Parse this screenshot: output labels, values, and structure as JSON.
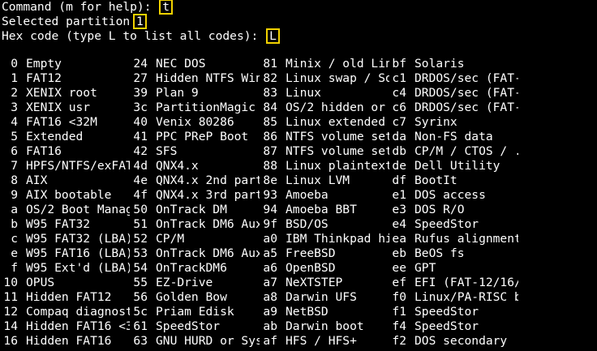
{
  "terminal": {
    "prompts": [
      {
        "text": "Command (m for help): ",
        "input": "t"
      },
      {
        "text": "Selected partition ",
        "input": "1"
      },
      {
        "text": "Hex code (type L to list all codes): ",
        "input": "L"
      }
    ],
    "partition_types": [
      [
        [
          "0",
          "Empty"
        ],
        [
          "24",
          "NEC DOS"
        ],
        [
          "81",
          "Minix / old Lin"
        ],
        [
          "bf",
          "Solaris"
        ]
      ],
      [
        [
          "1",
          "FAT12"
        ],
        [
          "27",
          "Hidden NTFS Win"
        ],
        [
          "82",
          "Linux swap / So"
        ],
        [
          "c1",
          "DRDOS/sec (FAT-"
        ]
      ],
      [
        [
          "2",
          "XENIX root"
        ],
        [
          "39",
          "Plan 9"
        ],
        [
          "83",
          "Linux"
        ],
        [
          "c4",
          "DRDOS/sec (FAT-"
        ]
      ],
      [
        [
          "3",
          "XENIX usr"
        ],
        [
          "3c",
          "PartitionMagic"
        ],
        [
          "84",
          "OS/2 hidden or"
        ],
        [
          "c6",
          "DRDOS/sec (FAT-"
        ]
      ],
      [
        [
          "4",
          "FAT16 <32M"
        ],
        [
          "40",
          "Venix 80286"
        ],
        [
          "85",
          "Linux extended"
        ],
        [
          "c7",
          "Syrinx"
        ]
      ],
      [
        [
          "5",
          "Extended"
        ],
        [
          "41",
          "PPC PReP Boot"
        ],
        [
          "86",
          "NTFS volume set"
        ],
        [
          "da",
          "Non-FS data"
        ]
      ],
      [
        [
          "6",
          "FAT16"
        ],
        [
          "42",
          "SFS"
        ],
        [
          "87",
          "NTFS volume set"
        ],
        [
          "db",
          "CP/M / CTOS / ."
        ]
      ],
      [
        [
          "7",
          "HPFS/NTFS/exFAT"
        ],
        [
          "4d",
          "QNX4.x"
        ],
        [
          "88",
          "Linux plaintext"
        ],
        [
          "de",
          "Dell Utility"
        ]
      ],
      [
        [
          "8",
          "AIX"
        ],
        [
          "4e",
          "QNX4.x 2nd part"
        ],
        [
          "8e",
          "Linux LVM"
        ],
        [
          "df",
          "BootIt"
        ]
      ],
      [
        [
          "9",
          "AIX bootable"
        ],
        [
          "4f",
          "QNX4.x 3rd part"
        ],
        [
          "93",
          "Amoeba"
        ],
        [
          "e1",
          "DOS access"
        ]
      ],
      [
        [
          "a",
          "OS/2 Boot Manag"
        ],
        [
          "50",
          "OnTrack DM"
        ],
        [
          "94",
          "Amoeba BBT"
        ],
        [
          "e3",
          "DOS R/O"
        ]
      ],
      [
        [
          "b",
          "W95 FAT32"
        ],
        [
          "51",
          "OnTrack DM6 Aux"
        ],
        [
          "9f",
          "BSD/OS"
        ],
        [
          "e4",
          "SpeedStor"
        ]
      ],
      [
        [
          "c",
          "W95 FAT32 (LBA)"
        ],
        [
          "52",
          "CP/M"
        ],
        [
          "a0",
          "IBM Thinkpad hi"
        ],
        [
          "ea",
          "Rufus alignment"
        ]
      ],
      [
        [
          "e",
          "W95 FAT16 (LBA)"
        ],
        [
          "53",
          "OnTrack DM6 Aux"
        ],
        [
          "a5",
          "FreeBSD"
        ],
        [
          "eb",
          "BeOS fs"
        ]
      ],
      [
        [
          "f",
          "W95 Ext'd (LBA)"
        ],
        [
          "54",
          "OnTrackDM6"
        ],
        [
          "a6",
          "OpenBSD"
        ],
        [
          "ee",
          "GPT"
        ]
      ],
      [
        [
          "10",
          "OPUS"
        ],
        [
          "55",
          "EZ-Drive"
        ],
        [
          "a7",
          "NeXTSTEP"
        ],
        [
          "ef",
          "EFI (FAT-12/16/"
        ]
      ],
      [
        [
          "11",
          "Hidden FAT12"
        ],
        [
          "56",
          "Golden Bow"
        ],
        [
          "a8",
          "Darwin UFS"
        ],
        [
          "f0",
          "Linux/PA-RISC b"
        ]
      ],
      [
        [
          "12",
          "Compaq diagnost"
        ],
        [
          "5c",
          "Priam Edisk"
        ],
        [
          "a9",
          "NetBSD"
        ],
        [
          "f1",
          "SpeedStor"
        ]
      ],
      [
        [
          "14",
          "Hidden FAT16 <3"
        ],
        [
          "61",
          "SpeedStor"
        ],
        [
          "ab",
          "Darwin boot"
        ],
        [
          "f4",
          "SpeedStor"
        ]
      ],
      [
        [
          "16",
          "Hidden FAT16"
        ],
        [
          "63",
          "GNU HURD or Sys"
        ],
        [
          "af",
          "HFS / HFS+"
        ],
        [
          "f2",
          "DOS secondary"
        ]
      ]
    ],
    "highlight_color": "#f2d200",
    "background": "#000000",
    "foreground": "#ffffff"
  }
}
